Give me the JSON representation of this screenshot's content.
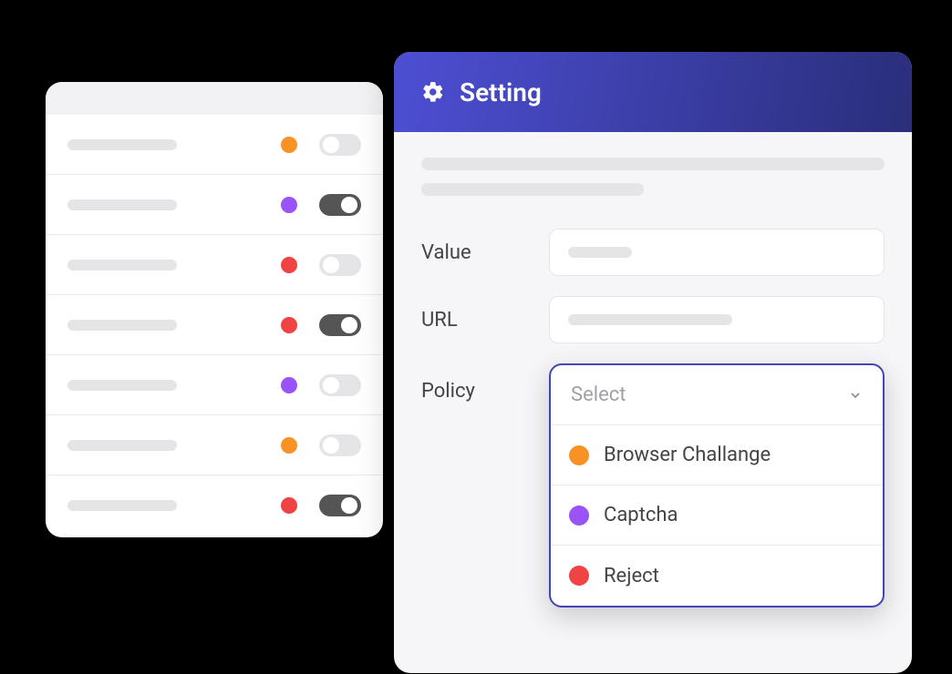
{
  "colors": {
    "orange": "#f89226",
    "purple": "#9a53f6",
    "red": "#f04343"
  },
  "list": {
    "rows": [
      {
        "color": "orange",
        "toggle": "off"
      },
      {
        "color": "purple",
        "toggle": "on"
      },
      {
        "color": "red",
        "toggle": "off"
      },
      {
        "color": "red",
        "toggle": "on"
      },
      {
        "color": "purple",
        "toggle": "off"
      },
      {
        "color": "orange",
        "toggle": "off"
      },
      {
        "color": "red",
        "toggle": "on"
      }
    ]
  },
  "setting": {
    "title": "Setting",
    "fields": {
      "value_label": "Value",
      "url_label": "URL",
      "policy_label": "Policy"
    },
    "policy": {
      "placeholder": "Select",
      "options": [
        {
          "label": "Browser Challange",
          "color": "orange"
        },
        {
          "label": "Captcha",
          "color": "purple"
        },
        {
          "label": "Reject",
          "color": "red"
        }
      ]
    }
  }
}
